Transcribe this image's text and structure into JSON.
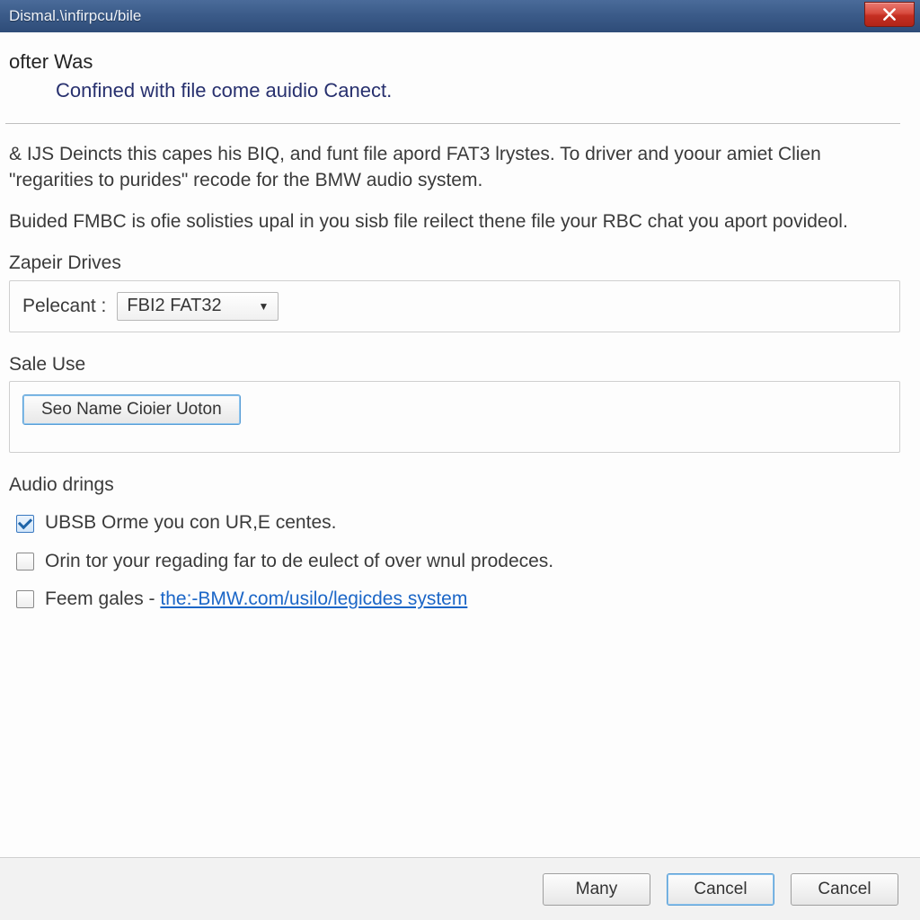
{
  "window": {
    "title": "Dismal.\\infirpcu/bile"
  },
  "header": {
    "heading": "ofter Was",
    "subtitle": "Confined with file come auidio Canect."
  },
  "body": {
    "para1": "& IJS Deincts this capes his BIQ, and funt file apord FAT3 lrystes. To driver and yoour amiet Clien \"regarities to purides\" recode for the BMW audio system.",
    "para2": "Buided FMBC is ofie solisties upal in you sisb file reilect thene file your RBC chat you aport povideol."
  },
  "drives": {
    "group_label": "Zapeir Drives",
    "field_label": "Pelecant :",
    "selected": "FBI2 FAT32"
  },
  "sale_use": {
    "group_label": "Sale Use",
    "button_label": "Seo Name Cioier Uoton"
  },
  "audio": {
    "group_label": "Audio drings",
    "opt1": {
      "checked": true,
      "label": "UBSB Orme you con UR,E centes."
    },
    "opt2": {
      "checked": false,
      "label": "Orin tor your regading far to de eulect of over wnul prodeces."
    },
    "opt3": {
      "checked": false,
      "prefix": "Feem gales - ",
      "link": "the:-BMW.com/usilo/legicdes system"
    }
  },
  "footer": {
    "btn1": "Many",
    "btn2": "Cancel",
    "btn3": "Cancel"
  }
}
